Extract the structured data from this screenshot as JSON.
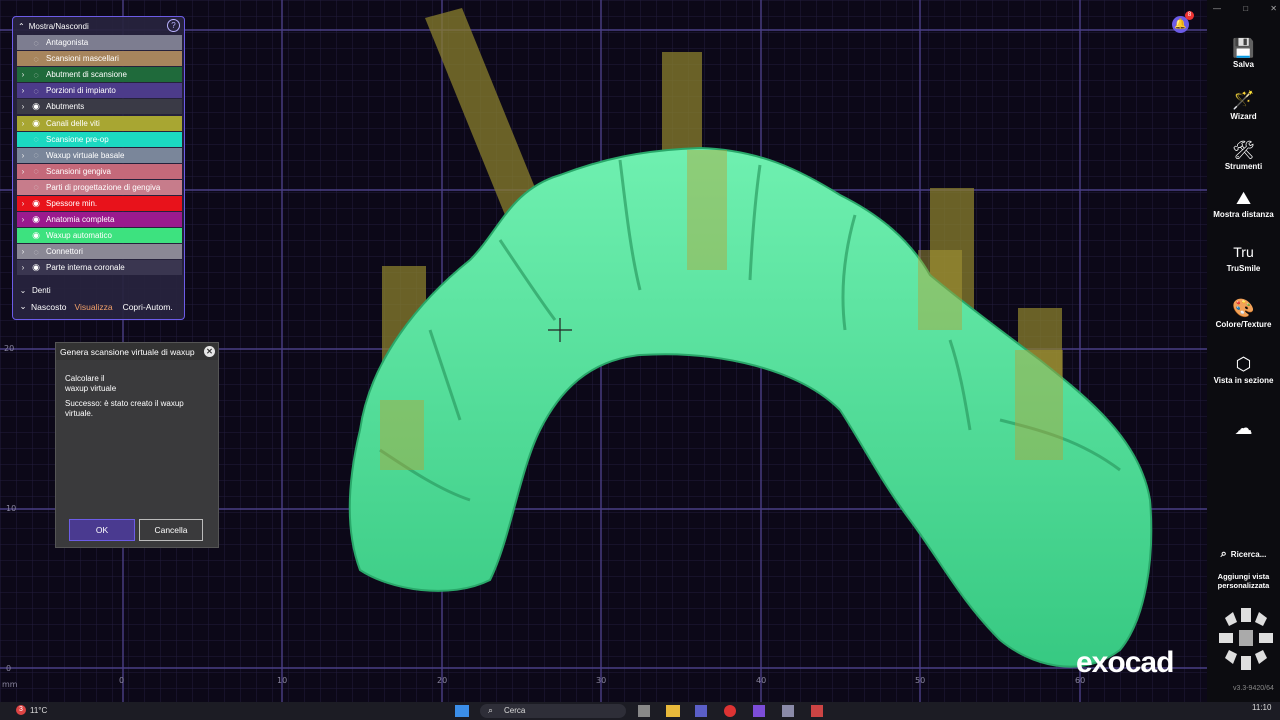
{
  "window": {
    "controls": [
      "—",
      "□",
      "✕"
    ]
  },
  "panel": {
    "title": "Mostra/Nascondi",
    "help": "?",
    "rows": [
      {
        "label": "Antagonista",
        "color": "#7d7d90",
        "chev": "",
        "eye": "hidden"
      },
      {
        "label": "Scansioni mascellari",
        "color": "#a7855d",
        "chev": "",
        "eye": "hidden"
      },
      {
        "label": "Abutment di scansione",
        "color": "#1f6a3b",
        "chev": "›",
        "eye": "hidden"
      },
      {
        "label": "Porzioni di impianto",
        "color": "#4c3b8a",
        "chev": "›",
        "eye": "hidden"
      },
      {
        "label": "Abutments",
        "color": "#3a3a46",
        "chev": "›",
        "eye": "visible"
      },
      {
        "label": "Canali delle viti",
        "color": "#a8a632",
        "chev": "›",
        "eye": "visible"
      },
      {
        "label": "Scansione pre-op",
        "color": "#1bd9c1",
        "chev": "",
        "eye": "hidden"
      },
      {
        "label": "Waxup virtuale basale",
        "color": "#7a869a",
        "chev": "›",
        "eye": "hidden"
      },
      {
        "label": "Scansioni gengiva",
        "color": "#c5697a",
        "chev": "›",
        "eye": "hidden"
      },
      {
        "label": "Parti di progettazione di gengiva",
        "color": "#c77c8b",
        "chev": "",
        "eye": "hidden"
      },
      {
        "label": "Spessore min.",
        "color": "#e8121b",
        "chev": "›",
        "eye": "visible"
      },
      {
        "label": "Anatomia completa",
        "color": "#9b1a8e",
        "chev": "›",
        "eye": "visible"
      },
      {
        "label": "Waxup automatico",
        "color": "#3de27f",
        "chev": "",
        "eye": "visible"
      },
      {
        "label": "Connettori",
        "color": "#8a8895",
        "chev": "›",
        "eye": "hidden"
      },
      {
        "label": "Parte interna coronale",
        "color": "#3a3650",
        "chev": "›",
        "eye": "visible"
      }
    ],
    "group_denti": "Denti",
    "footer": {
      "nascosto": "Nascosto",
      "visualizza": "Visualizza",
      "copri": "Copri-Autom."
    }
  },
  "dialog": {
    "title": "Genera scansione virtuale di waxup",
    "close": "✕",
    "line1": "Calcolare il",
    "line2": "waxup virtuale",
    "line3": "Successo: è stato creato il waxup",
    "line4": "virtuale.",
    "ok": "OK",
    "cancel": "Cancella"
  },
  "toolbar": {
    "tools": [
      {
        "label": "Salva",
        "icon": "save-icon",
        "glyph": "💾"
      },
      {
        "label": "Wizard",
        "icon": "wizard-icon",
        "glyph": "🪄"
      },
      {
        "label": "Strumenti",
        "icon": "tools-icon",
        "glyph": "🛠"
      },
      {
        "label": "Mostra distanza",
        "icon": "distance-icon",
        "glyph": "⛰"
      },
      {
        "label": "TruSmile",
        "icon": "trusmile-icon",
        "glyph": "Tru"
      },
      {
        "label": "Colore/Texture",
        "icon": "color-texture-icon",
        "glyph": "🎨"
      },
      {
        "label": "Vista in sezione",
        "icon": "section-view-icon",
        "glyph": "⬡"
      }
    ],
    "search": "Ricerca...",
    "add_view": "Aggiungi vista personalizzata",
    "version": "v3.3-9420/64"
  },
  "viewport": {
    "brand": "exocad",
    "x_ticks": [
      "0",
      "10",
      "20",
      "30",
      "40",
      "50",
      "60"
    ],
    "y_ticks": [
      "20",
      "10",
      "0"
    ],
    "unit": "mm",
    "notification_count": "8"
  },
  "taskbar": {
    "weather": "11°C",
    "weather_badge": "3",
    "search": "Cerca",
    "time": "11:10"
  },
  "colors": {
    "tooth": "#4fe39a",
    "accent": "#6c5ce7",
    "grid": "#3b3366"
  }
}
